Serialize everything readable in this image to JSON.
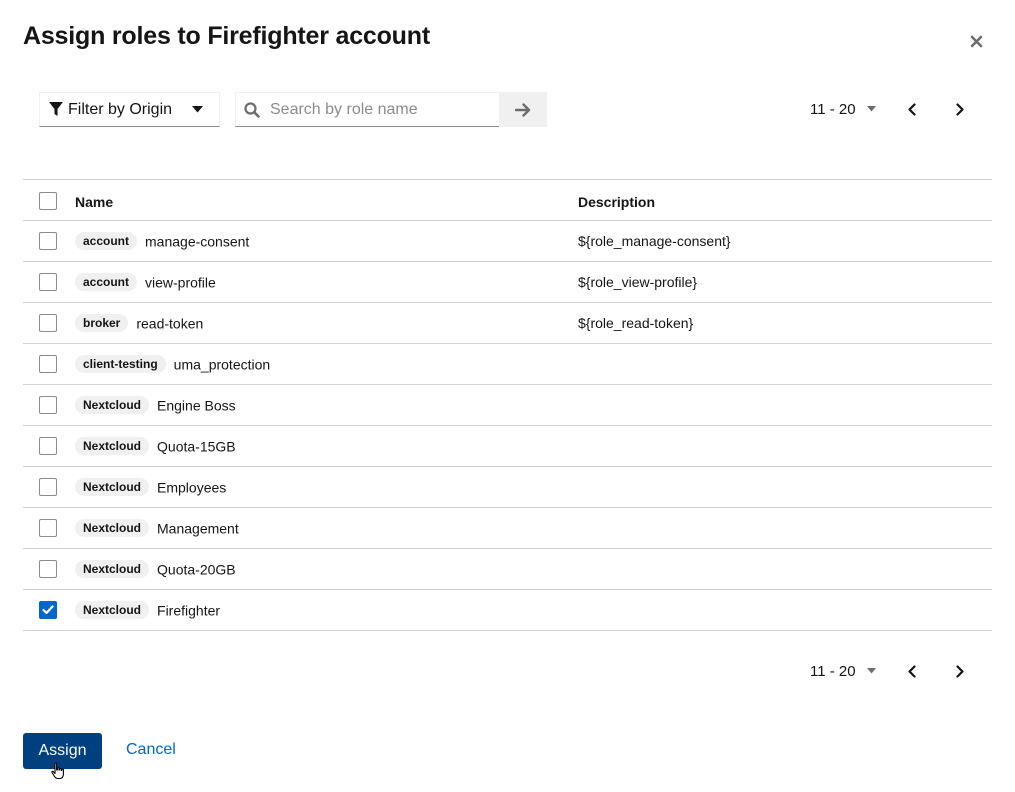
{
  "modal": {
    "title": "Assign roles to Firefighter account"
  },
  "toolbar": {
    "filter_label": "Filter by Origin",
    "search_placeholder": "Search by role name",
    "pagination_range": "11 - 20"
  },
  "table": {
    "columns": [
      "Name",
      "Description"
    ],
    "rows": [
      {
        "client": "account",
        "role": "manage-consent",
        "description": "${role_manage-consent}",
        "checked": false
      },
      {
        "client": "account",
        "role": "view-profile",
        "description": "${role_view-profile}",
        "checked": false
      },
      {
        "client": "broker",
        "role": "read-token",
        "description": "${role_read-token}",
        "checked": false
      },
      {
        "client": "client-testing",
        "role": "uma_protection",
        "description": "",
        "checked": false
      },
      {
        "client": "Nextcloud",
        "role": "Engine Boss",
        "description": "",
        "checked": false
      },
      {
        "client": "Nextcloud",
        "role": "Quota-15GB",
        "description": "",
        "checked": false
      },
      {
        "client": "Nextcloud",
        "role": "Employees",
        "description": "",
        "checked": false
      },
      {
        "client": "Nextcloud",
        "role": "Management",
        "description": "",
        "checked": false
      },
      {
        "client": "Nextcloud",
        "role": "Quota-20GB",
        "description": "",
        "checked": false
      },
      {
        "client": "Nextcloud",
        "role": "Firefighter",
        "description": "",
        "checked": true
      }
    ]
  },
  "footer": {
    "pagination_range": "11 - 20",
    "assign_label": "Assign",
    "cancel_label": "Cancel"
  },
  "colors": {
    "primary": "#004080",
    "link": "#0066cc",
    "checkbox_checked": "#0066cc"
  }
}
